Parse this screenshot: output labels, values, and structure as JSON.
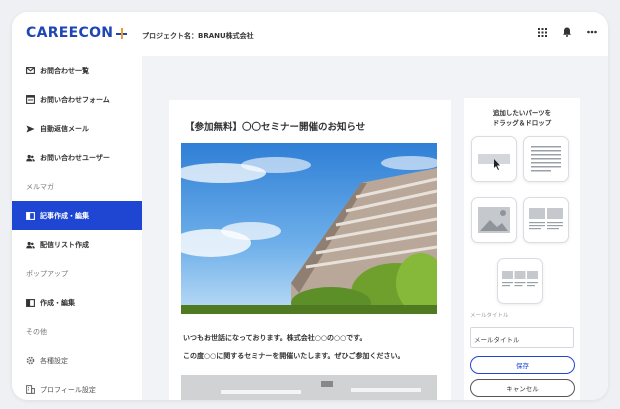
{
  "app": {
    "logo": "CAREECON"
  },
  "header": {
    "project": "プロジェクト名：BRANU株式会社",
    "icons": [
      "grid-icon",
      "bell-icon",
      "more-icon"
    ]
  },
  "sidebar": {
    "items": [
      {
        "label": "お問合わせ一覧",
        "icon": "mail-icon"
      },
      {
        "label": "お問い合わせフォーム",
        "icon": "form-icon"
      },
      {
        "label": "自動返信メール",
        "icon": "send-icon"
      },
      {
        "label": "お問い合わせユーザー",
        "icon": "users-icon"
      },
      {
        "label": "メルマガ",
        "section": true
      },
      {
        "label": "記事作成・編集",
        "icon": "article-icon",
        "active": true
      },
      {
        "label": "配信リスト作成",
        "icon": "users-icon"
      },
      {
        "label": "ポップアップ",
        "section": true
      },
      {
        "label": "作成・編集",
        "icon": "article-icon"
      },
      {
        "label": "その他",
        "section": true
      },
      {
        "label": "各種設定",
        "icon": "gear-icon"
      },
      {
        "label": "プロフィール設定",
        "icon": "building-icon"
      }
    ]
  },
  "mail": {
    "title": "【参加無料】〇〇セミナー開催のお知らせ",
    "line1": "いつもお世話になっております。株式会社○○の○○です。",
    "line2": "この度○○に関するセミナーを開催いたします。ぜひご参加ください。"
  },
  "panel": {
    "heading_line1": "追加したいパーツを",
    "heading_line2": "ドラッグ＆ドロップ",
    "field_label": "メールタイトル",
    "field_value": "メールタイトル",
    "save": "保存",
    "cancel": "キャンセル"
  },
  "colors": {
    "brand": "#1e46b4",
    "active": "#1e46d2",
    "accent": "#f0a020"
  }
}
